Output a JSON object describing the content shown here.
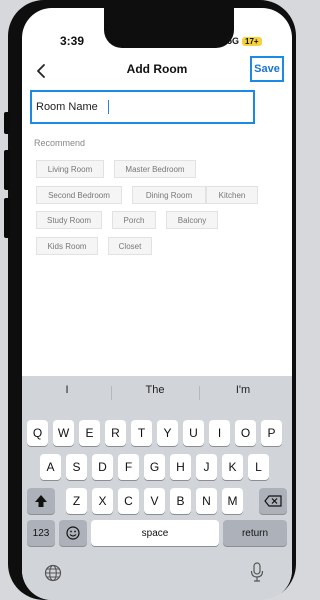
{
  "status_bar": {
    "time": "3:39",
    "network": "5G",
    "battery": "17+"
  },
  "nav": {
    "title": "Add Room",
    "save_label": "Save",
    "back_icon": "chevron-left-icon"
  },
  "room_field": {
    "placeholder": "Room Name"
  },
  "recommend": {
    "heading": "Recommend",
    "rows": [
      [
        "Living Room",
        "Master Bedroom"
      ],
      [
        "Second Bedroom",
        "Dining Room",
        "Kitchen"
      ],
      [
        "Study Room",
        "Porch",
        "Balcony"
      ],
      [
        "Kids Room",
        "Closet"
      ]
    ]
  },
  "keyboard": {
    "suggestions": [
      "I",
      "The",
      "I'm"
    ],
    "row1": [
      "Q",
      "W",
      "E",
      "R",
      "T",
      "Y",
      "U",
      "I",
      "O",
      "P"
    ],
    "row2": [
      "A",
      "S",
      "D",
      "F",
      "G",
      "H",
      "J",
      "K",
      "L"
    ],
    "row3": [
      "Z",
      "X",
      "C",
      "V",
      "B",
      "N",
      "M"
    ],
    "numbers_key": "123",
    "space_key": "space",
    "return_key": "return",
    "shift_icon": "shift-icon",
    "delete_icon": "delete-icon",
    "emoji_icon": "emoji-icon",
    "globe_icon": "globe-icon",
    "mic_icon": "microphone-icon"
  },
  "colors": {
    "accent": "#1a8ae6",
    "keyboard_bg": "#d1d4d9"
  }
}
